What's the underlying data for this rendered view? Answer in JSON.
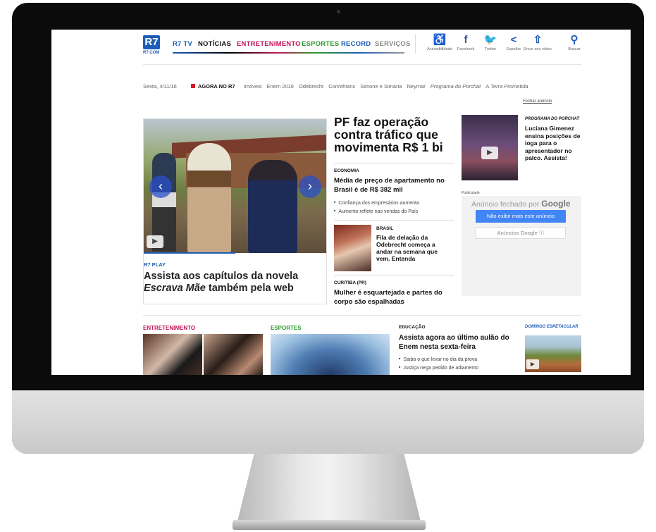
{
  "site": {
    "logo_text": "R7",
    "logo_sub": "R7.COM"
  },
  "nav": {
    "items": [
      {
        "label": "R7 TV",
        "color": "#1e5db6"
      },
      {
        "label": "NOTÍCIAS",
        "color": "#111111"
      },
      {
        "label": "ENTRETENIMENTO",
        "color": "#c2185b"
      },
      {
        "label": "ESPORTES",
        "color": "#2e9b2e"
      },
      {
        "label": "RECORD",
        "color": "#1e5db6"
      },
      {
        "label": "SERVIÇOS",
        "color": "#888888"
      }
    ],
    "social": [
      {
        "icon": "accessibility-icon",
        "glyph": "♿",
        "label": "Acessibilidade",
        "color": "#222222"
      },
      {
        "icon": "facebook-icon",
        "glyph": "f",
        "label": "Facebook",
        "color": "#3b5998"
      },
      {
        "icon": "twitter-icon",
        "glyph": "🐦",
        "label": "Twitter",
        "color": "#1da1f2"
      },
      {
        "icon": "share-icon",
        "glyph": "<",
        "label": "Espalhe",
        "color": "#1e5db6"
      },
      {
        "icon": "upload-video-icon",
        "glyph": "⇧",
        "label": "Envie seu vídeo",
        "color": "#1e5db6"
      },
      {
        "icon": "search-icon",
        "glyph": "⚲",
        "label": "Buscar",
        "color": "#1e5db6"
      }
    ]
  },
  "trending": {
    "date": "Sexta, 4/11/16",
    "agora": "AGORA NO R7",
    "items": [
      "Imóveis",
      "Enem 2016",
      "Odebrecht",
      "Corinthians",
      "Simone e Simaria",
      "Neymar"
    ],
    "italic_items": [
      "Programa do Porchat",
      "A Terra Prometida"
    ]
  },
  "ad": {
    "close_link": "Fechar anúncio",
    "label": "Publicidade",
    "closed_text": "Anúncio fechado por",
    "closed_brand": "Google",
    "button_primary": "Não exibir mais este anúncio",
    "button_secondary": "Anúncios Google ⓘ"
  },
  "feature": {
    "hat": "R7 PLAY",
    "title_pre": "Assista aos capítulos da novela",
    "title_em": "Escrava Mãe",
    "title_post": "também pela web"
  },
  "middle": {
    "headline": "PF faz operação contra tráfico que movimenta R$ 1 bi",
    "story1": {
      "hat": "ECONOMIA",
      "title": "Média de preço de apartamento no Brasil é de R$ 382 mil",
      "bullets": [
        "Confiança dos empresários aumenta",
        "Aumento reflete nas vendas do País"
      ]
    },
    "story2": {
      "hat": "BRASIL",
      "title": "Fila de delação da Odebrecht começa a andar na semana que vem. Entenda"
    },
    "story3": {
      "hat": "CURITIBA (PR)",
      "title": "Mulher é esquartejada e partes do corpo são espalhadas"
    }
  },
  "right": {
    "hat": "PROGRAMA DO PORCHAT",
    "title": "Luciana Gimenez ensina posições de ioga para o apresentador no palco. Assista!"
  },
  "bottom": {
    "entretenimento": "ENTRETENIMENTO",
    "esportes": "ESPORTES",
    "edu_hat": "EDUCAÇÃO",
    "edu_title": "Assista agora ao último aulão do Enem nesta sexta-feira",
    "edu_bullets": [
      "Saiba o que levar no dia da prova",
      "Justiça nega pedido de adiamento"
    ],
    "dom_hat": "DOMINGO ESPETACULAR"
  }
}
